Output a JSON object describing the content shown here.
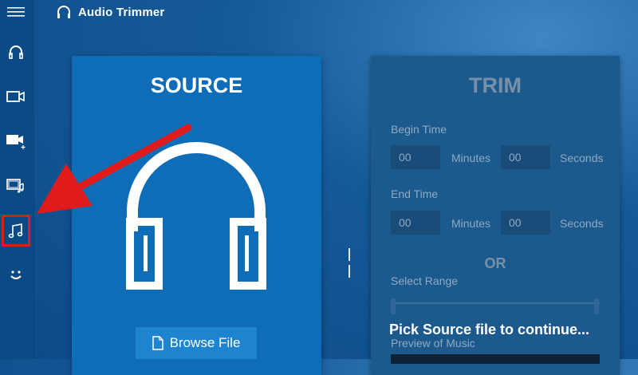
{
  "app": {
    "title": "Audio Trimmer"
  },
  "sidebar": {
    "items": [
      {
        "icon": "hamburger-menu-icon"
      },
      {
        "icon": "headphones-icon"
      },
      {
        "icon": "video-camera-icon"
      },
      {
        "icon": "video-add-icon"
      },
      {
        "icon": "video-music-icon"
      },
      {
        "icon": "music-notes-icon",
        "selected": true
      },
      {
        "icon": "smiley-icon"
      }
    ]
  },
  "source": {
    "title": "SOURCE",
    "browse_label": "Browse File"
  },
  "trim": {
    "title": "TRIM",
    "begin_label": "Begin Time",
    "begin_minutes": "00",
    "begin_seconds": "00",
    "end_label": "End Time",
    "end_minutes": "00",
    "end_seconds": "00",
    "minutes_label": "Minutes",
    "seconds_label": "Seconds",
    "or_label": "OR",
    "range_label": "Select Range",
    "preview_label": "Preview of Music"
  },
  "overlay": {
    "message": "Pick Source file to continue..."
  },
  "colors": {
    "accent": "#0f6cb7",
    "annotation": "#e01b1b"
  }
}
